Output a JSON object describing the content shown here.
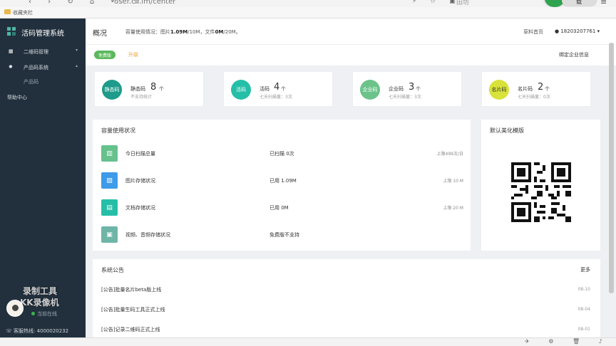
{
  "browser": {
    "url": "user.cli.im/center",
    "nav_glyphs": "‹ › ↻ ⌂ ↶ ☆",
    "right_glyphs": "⚡ ☆ ▣",
    "profile_label": "田坊",
    "pill_label": "载",
    "bookmark_label": "收藏夹栏",
    "status_glyphs": "✈ ⚙ 🗑 ♪ ▢ ⌕"
  },
  "sidebar": {
    "title": "活码管理系统",
    "items": [
      {
        "label": "二维码管理",
        "icon": "grid-icon"
      },
      {
        "label": "产品码系统",
        "icon": "sun-icon"
      }
    ],
    "sub_item": "产品码",
    "help": "帮助中心",
    "watermark_line1": "录制工具",
    "watermark_line2": "KK录像机",
    "online_status": "当前在线",
    "hotline": "客服热线: 4000020232"
  },
  "header": {
    "page_title": "概况",
    "usage_prefix": "容量使用情况：图片",
    "image_used": "1.09M",
    "image_total": "/10M，文件",
    "file_used": "0M",
    "file_total": "/20M。",
    "homepage_link": "草料首页",
    "account": "18203207761"
  },
  "subbar": {
    "plan_badge": "免费版",
    "upgrade": "升级",
    "bind_info": "绑定企业信息"
  },
  "stats": [
    {
      "icon_text": "静态码",
      "name": "静态码",
      "count": "8",
      "unit": "个",
      "sub": "不支持统计",
      "color": "#1e9b8a"
    },
    {
      "icon_text": "活码",
      "name": "活码",
      "count": "4",
      "unit": "个",
      "sub": "七天扫描量：3次",
      "color": "#25bfa8"
    },
    {
      "icon_text": "企业码",
      "name": "企业码",
      "count": "3",
      "unit": "个",
      "sub": "七天扫描量：3次",
      "color": "#6cc38a"
    },
    {
      "icon_text": "名片码",
      "name": "名片码",
      "count": "2",
      "unit": "个",
      "sub": "七天扫描量：0次",
      "color": "#d8e23a"
    }
  ],
  "usage": {
    "title": "容量使用状况",
    "rows": [
      {
        "label": "今日扫描总量",
        "value": "已扫描 0次",
        "limit": "上限499次/日",
        "color": "#66c18c",
        "glyph": "▥"
      },
      {
        "label": "图片存储状况",
        "value": "已用 1.09M",
        "limit": "上限 10 M",
        "color": "#3d9be9",
        "glyph": "▨"
      },
      {
        "label": "文档存储状况",
        "value": "已用 0M",
        "limit": "上限 20 M",
        "color": "#25bfa8",
        "glyph": "▤"
      },
      {
        "label": "视频、音频存储状况",
        "value": "免费版不支持",
        "limit": "",
        "color": "#6eb5a8",
        "glyph": "▣"
      }
    ]
  },
  "template": {
    "title": "默认美化模版"
  },
  "notices": {
    "title": "系统公告",
    "more": "更多",
    "items": [
      {
        "text": "[公告]批量名片beta版上线",
        "date": "08-10"
      },
      {
        "text": "[公告]批量生码工具正式上线",
        "date": "08-04"
      },
      {
        "text": "[公告]记录二维码正式上线",
        "date": "08-01"
      }
    ]
  }
}
